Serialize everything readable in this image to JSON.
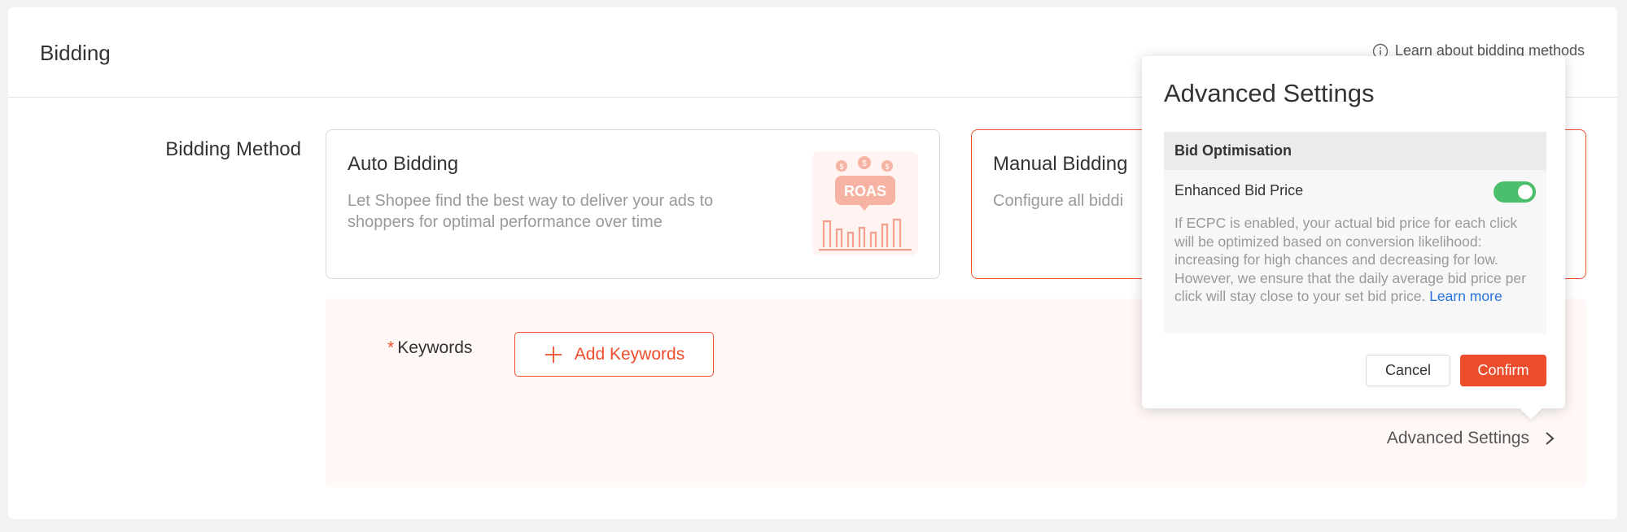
{
  "section": {
    "title": "Bidding",
    "help_link": "Learn about bidding methods",
    "help_icon": "info-icon"
  },
  "bidding_method": {
    "label": "Bidding Method",
    "options": [
      {
        "title": "Auto Bidding",
        "description": "Let Shopee find the best way to deliver your ads to shoppers for optimal performance over time",
        "illustration_text": "ROAS",
        "selected": false
      },
      {
        "title": "Manual Bidding",
        "description": "Configure all biddi",
        "selected": true
      }
    ]
  },
  "keywords": {
    "required_mark": "*",
    "label": "Keywords",
    "add_button": "Add Keywords"
  },
  "advanced_settings_link": "Advanced Settings",
  "popover": {
    "title": "Advanced Settings",
    "section_title": "Bid Optimisation",
    "toggle_label": "Enhanced Bid Price",
    "toggle_on": true,
    "description": "If ECPC is enabled, your actual bid price for each click will be optimized based on conversion likelihood: increasing for high chances and decreasing for low. However, we ensure that the daily average bid price per click will stay close to your set bid price.",
    "learn_more": "Learn more",
    "cancel_label": "Cancel",
    "confirm_label": "Confirm"
  },
  "colors": {
    "accent": "#ee4d2d",
    "toggle_on": "#4cbf6c",
    "link": "#2673dd"
  }
}
